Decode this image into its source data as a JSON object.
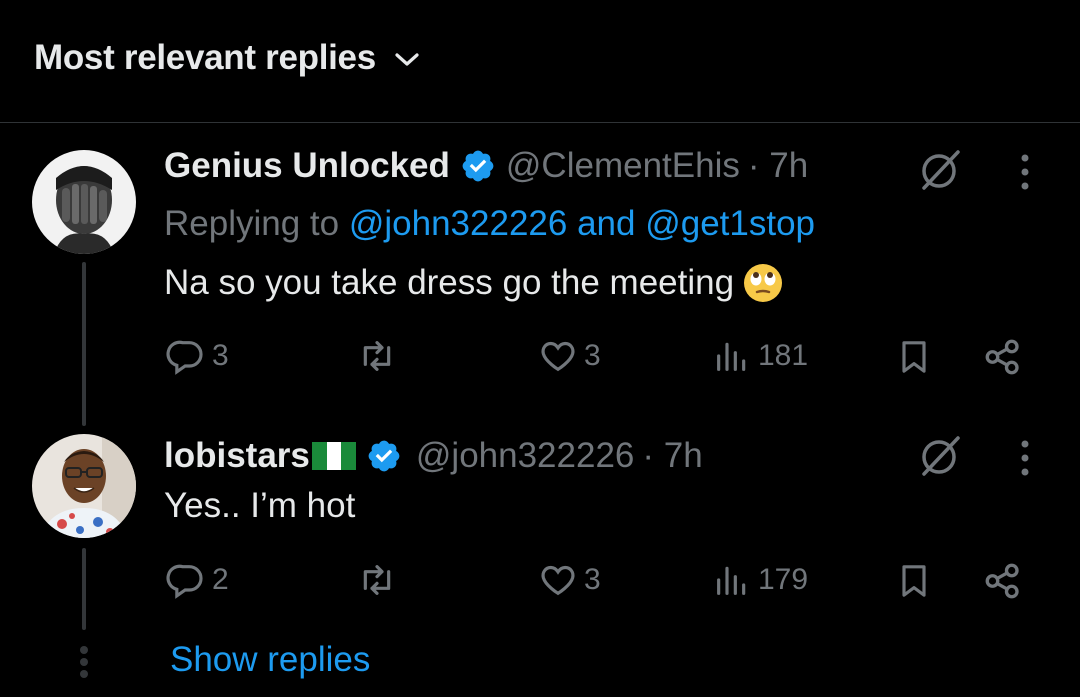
{
  "header": {
    "title": "Most relevant replies"
  },
  "replies": [
    {
      "display_name": "Genius Unlocked",
      "handle": "@ClementEhis",
      "time": "· 7h",
      "replying_prefix": "Replying to",
      "replying_user1": "@john322226",
      "replying_and": "and",
      "replying_user2": "@get1stop",
      "text": "Na so you take dress go the meeting",
      "emoji": "face-with-rolling-eyes",
      "stats": {
        "replies": "3",
        "likes": "3",
        "views": "181"
      }
    },
    {
      "display_name": "lobistars",
      "flag": "nigeria-flag",
      "handle": "@john322226",
      "time": "· 7h",
      "text": "Yes.. I’m hot",
      "stats": {
        "replies": "2",
        "likes": "3",
        "views": "179"
      }
    }
  ],
  "footer": {
    "show_replies": "Show replies"
  },
  "colors": {
    "background": "#000000",
    "text": "#e7e9ea",
    "muted": "#71767b",
    "accent": "#1d9bf0",
    "divider": "#2f3336"
  }
}
